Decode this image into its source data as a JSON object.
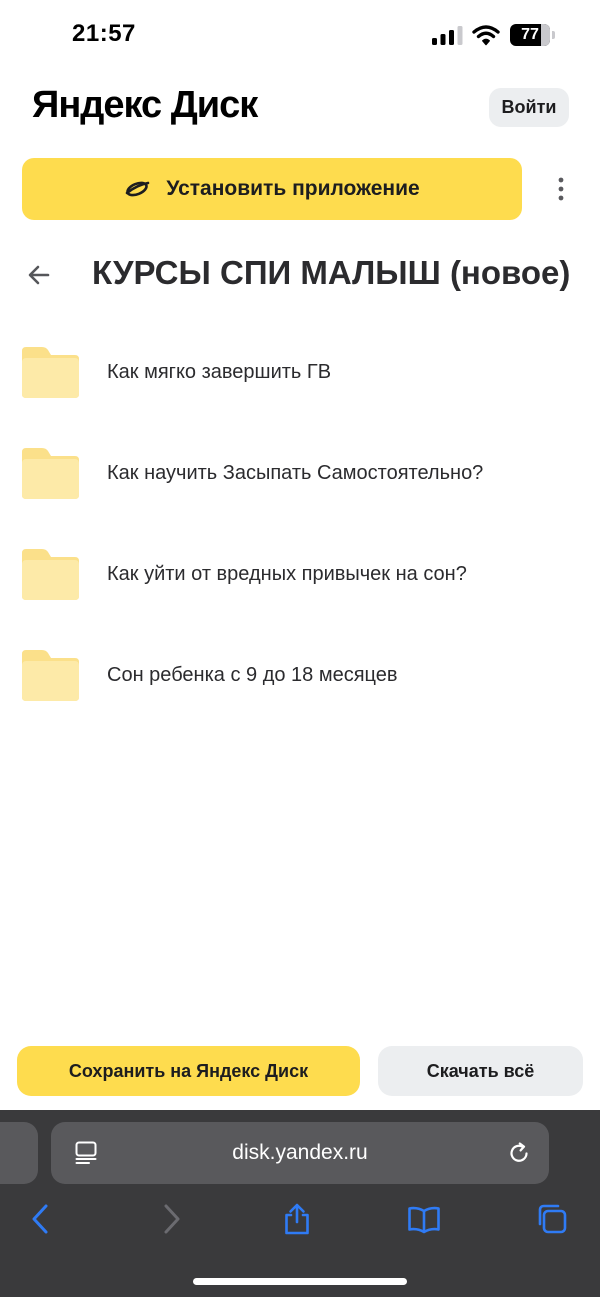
{
  "status_bar": {
    "time": "21:57",
    "battery_level": "77",
    "battery_fraction": 0.77,
    "icons": [
      "cellular-signal-icon",
      "wifi-icon",
      "battery-icon"
    ]
  },
  "header": {
    "brand": "Яндекс Диск",
    "login_label": "Войти"
  },
  "install_banner": {
    "label": "Установить приложение",
    "icon": "yandex-disk-logo-icon",
    "more_icon": "more-vertical-icon"
  },
  "folder": {
    "back_icon": "arrow-left-icon",
    "title": "КУРСЫ СПИ МАЛЫШ (новое)",
    "items": [
      {
        "name": "Как мягко завершить ГВ",
        "icon": "folder-icon"
      },
      {
        "name": "Как научить Засыпать Самостоятельно?",
        "icon": "folder-icon"
      },
      {
        "name": "Как уйти от вредных привычек на сон?",
        "icon": "folder-icon"
      },
      {
        "name": "Сон ребенка с 9 до 18 месяцев",
        "icon": "folder-icon"
      }
    ]
  },
  "actions": {
    "save_label": "Сохранить на Яндекс Диск",
    "download_label": "Скачать всё"
  },
  "browser": {
    "url": "disk.yandex.ru",
    "toolbar_icons": [
      "back-icon",
      "forward-icon",
      "share-icon",
      "bookmarks-icon",
      "tabs-icon"
    ]
  },
  "colors": {
    "accent_yellow": "#fedc4e",
    "secondary_button": "#eceef0",
    "folder_yellow": "#fde9a2",
    "browser_bar": "#3a3a3c",
    "browser_link_blue": "#2f7bf5"
  }
}
